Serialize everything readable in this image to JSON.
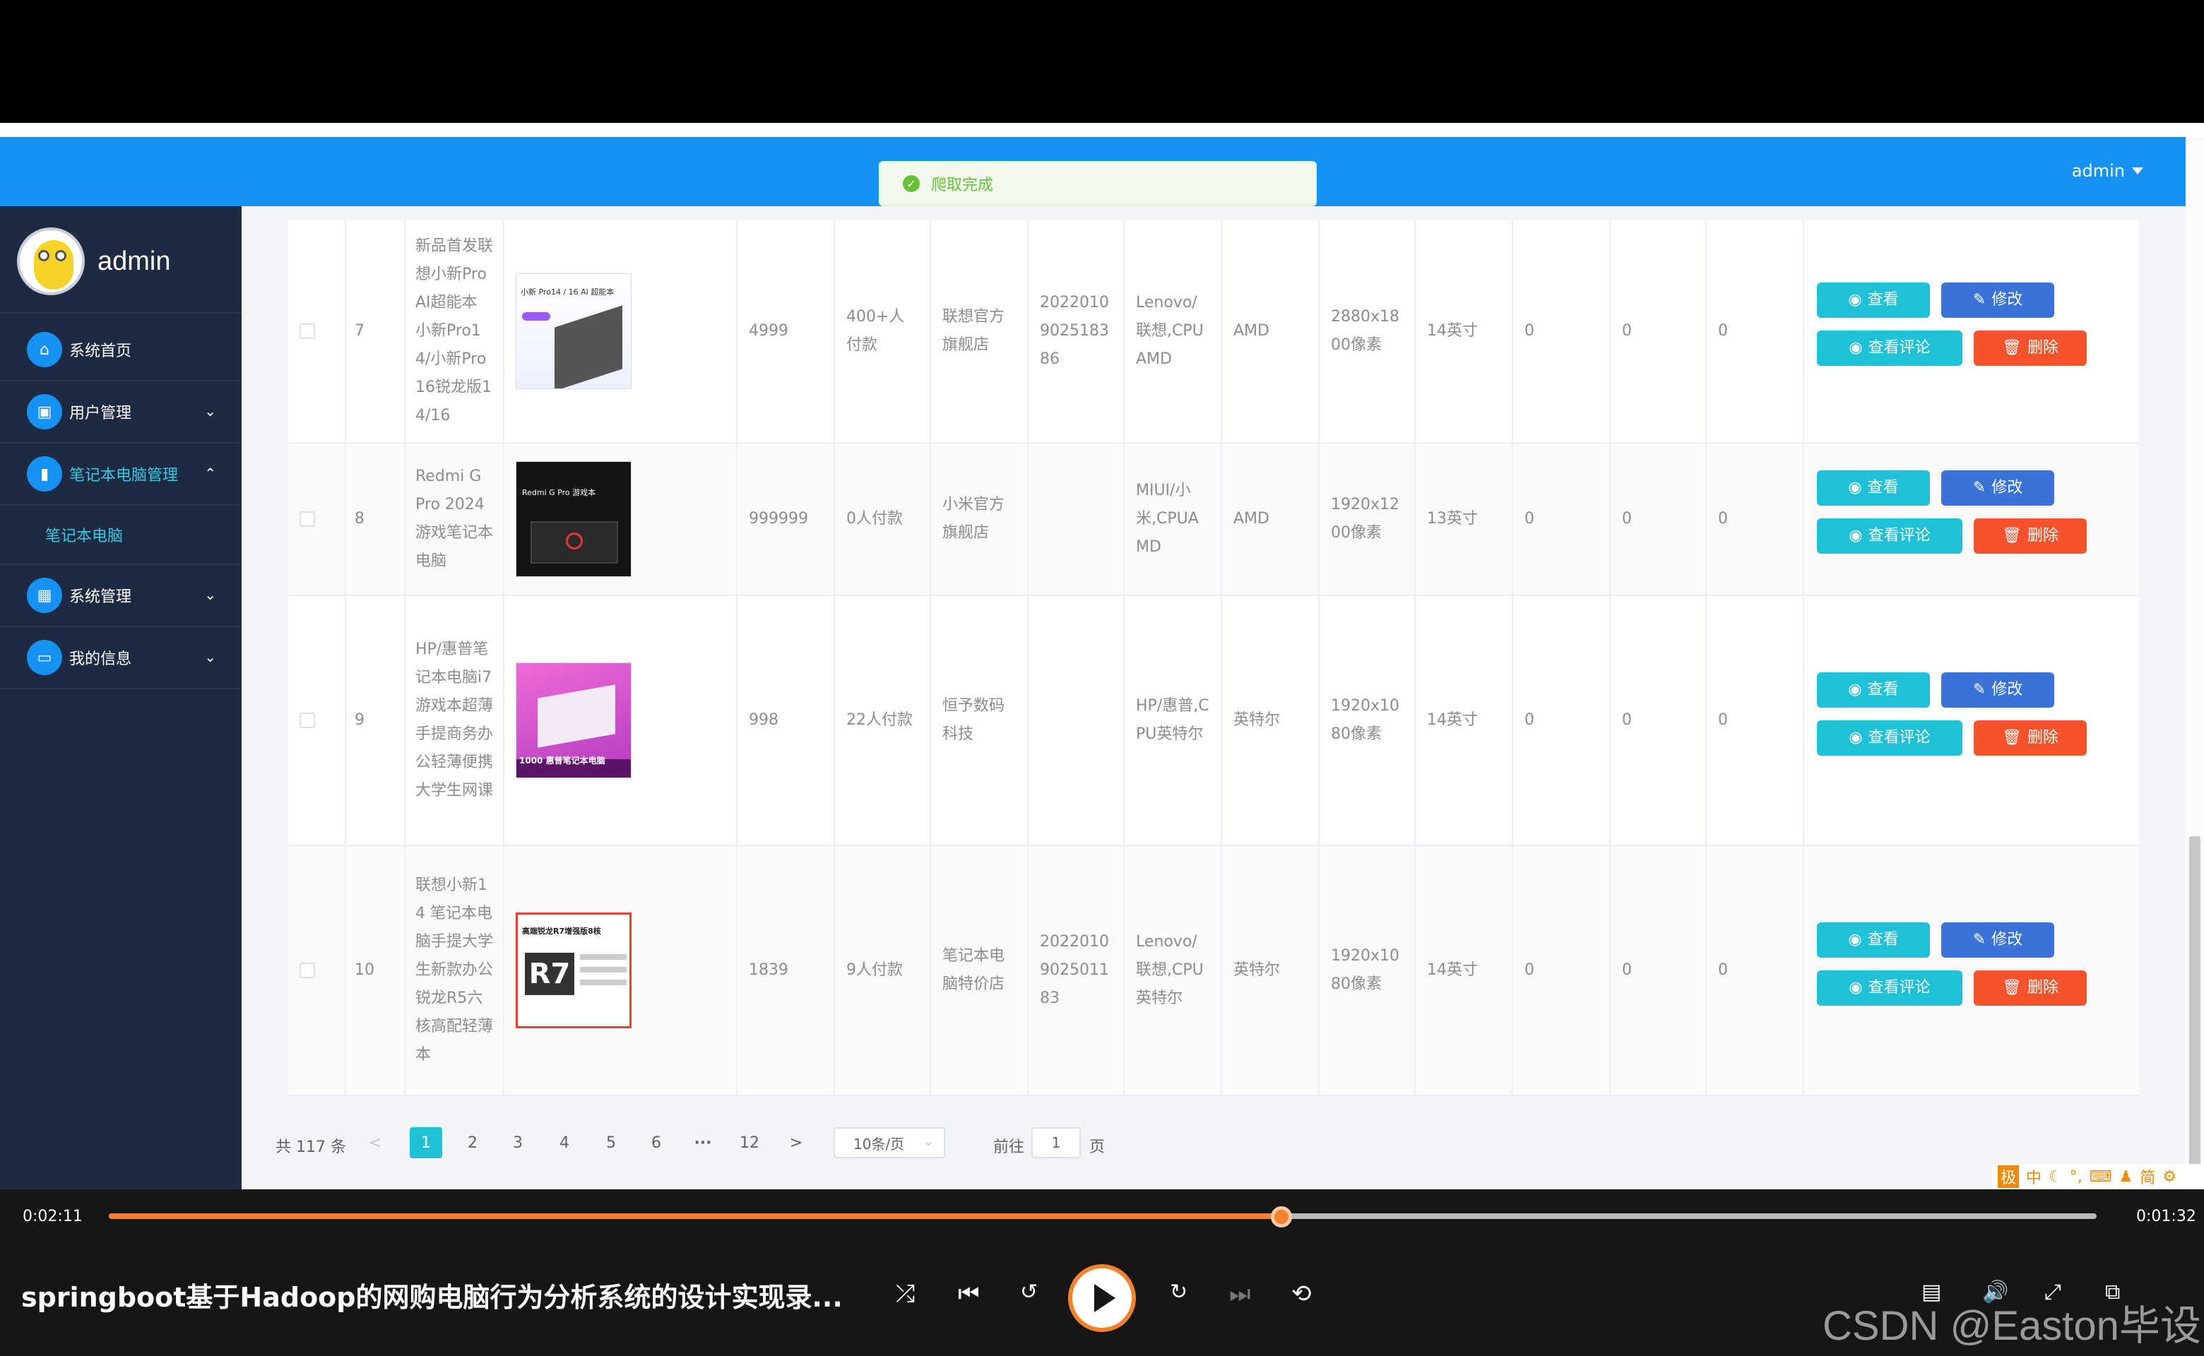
{
  "header": {
    "user": "admin"
  },
  "toast": {
    "message": "爬取完成"
  },
  "sidebar": {
    "brand": "admin",
    "items": [
      {
        "label": "系统首页",
        "icon": "home-icon"
      },
      {
        "label": "用户管理",
        "icon": "user-icon"
      },
      {
        "label": "笔记本电脑管理",
        "icon": "chart-icon"
      },
      {
        "label": "笔记本电脑",
        "sub": true
      },
      {
        "label": "系统管理",
        "icon": "grid-icon"
      },
      {
        "label": "我的信息",
        "icon": "card-icon"
      }
    ]
  },
  "table": {
    "rows": [
      {
        "index": "7",
        "title": "新品首发联想小新Pro AI超能本 小新Pro14/小新Pro16锐龙版14/16",
        "price": "4999",
        "buyers": "400+人付款",
        "shop": "联想官方旗舰店",
        "id": "20220109025183 86",
        "brand": "Lenovo/联想,CPU AMD",
        "cpu": "AMD",
        "resolution": "2880x1800像素",
        "size": "14英寸",
        "c1": "0",
        "c2": "0",
        "c3": "0",
        "img_caption": "小新 Pro14 / 16 AI 超能本"
      },
      {
        "index": "8",
        "title": "Redmi G Pro 2024 游戏笔记本电脑",
        "price": "999999",
        "buyers": "0人付款",
        "shop": "小米官方旗舰店",
        "id": "",
        "brand": "MIUI/小米,CPUAMD",
        "cpu": "AMD",
        "resolution": "1920x1200像素",
        "size": "13英寸",
        "c1": "0",
        "c2": "0",
        "c3": "0",
        "img_caption": "Redmi G Pro 游戏本"
      },
      {
        "index": "9",
        "title": "HP/惠普笔记本电脑i7游戏本超薄手提商务办公轻薄便携大学生网课",
        "price": "998",
        "buyers": "22人付款",
        "shop": "恒予数码科技",
        "id": "",
        "brand": "HP/惠普,CPU英特尔",
        "cpu": "英特尔",
        "resolution": "1920x1080像素",
        "size": "14英寸",
        "c1": "0",
        "c2": "0",
        "c3": "0",
        "img_caption": "1000 惠普笔记本电脑"
      },
      {
        "index": "10",
        "title": "联想小新14 笔记本电脑手提大学生新款办公锐龙R5六核高配轻薄本",
        "price": "1839",
        "buyers": "9人付款",
        "shop": "笔记本电脑特价店",
        "id": "20220109025011 83",
        "brand": "Lenovo/联想,CPU英特尔",
        "cpu": "英特尔",
        "resolution": "1920x1080像素",
        "size": "14英寸",
        "c1": "0",
        "c2": "0",
        "c3": "0",
        "img_caption": "高端锐龙R7增强版8核"
      }
    ],
    "buttons": {
      "view": "查看",
      "edit": "修改",
      "comments": "查看评论",
      "delete": "删除"
    }
  },
  "pagination": {
    "total": "共 117 条",
    "prev": "<",
    "pages": [
      "1",
      "2",
      "3",
      "4",
      "5",
      "6"
    ],
    "ellipsis": "···",
    "last": "12",
    "next": ">",
    "page_size": "10条/页",
    "goto_label": "前往",
    "goto_value": "1",
    "goto_suffix": "页"
  },
  "ime": {
    "items": [
      "极",
      "中",
      "简"
    ]
  },
  "player": {
    "elapsed": "0:02:11",
    "remaining": "0:01:32",
    "progress": 0.59,
    "title": "springboot基于Hadoop的网购电脑行为分析系统的设计实现录...",
    "watermark": "CSDN @Easton毕设",
    "colors": {
      "accent": "#f5822b"
    }
  }
}
